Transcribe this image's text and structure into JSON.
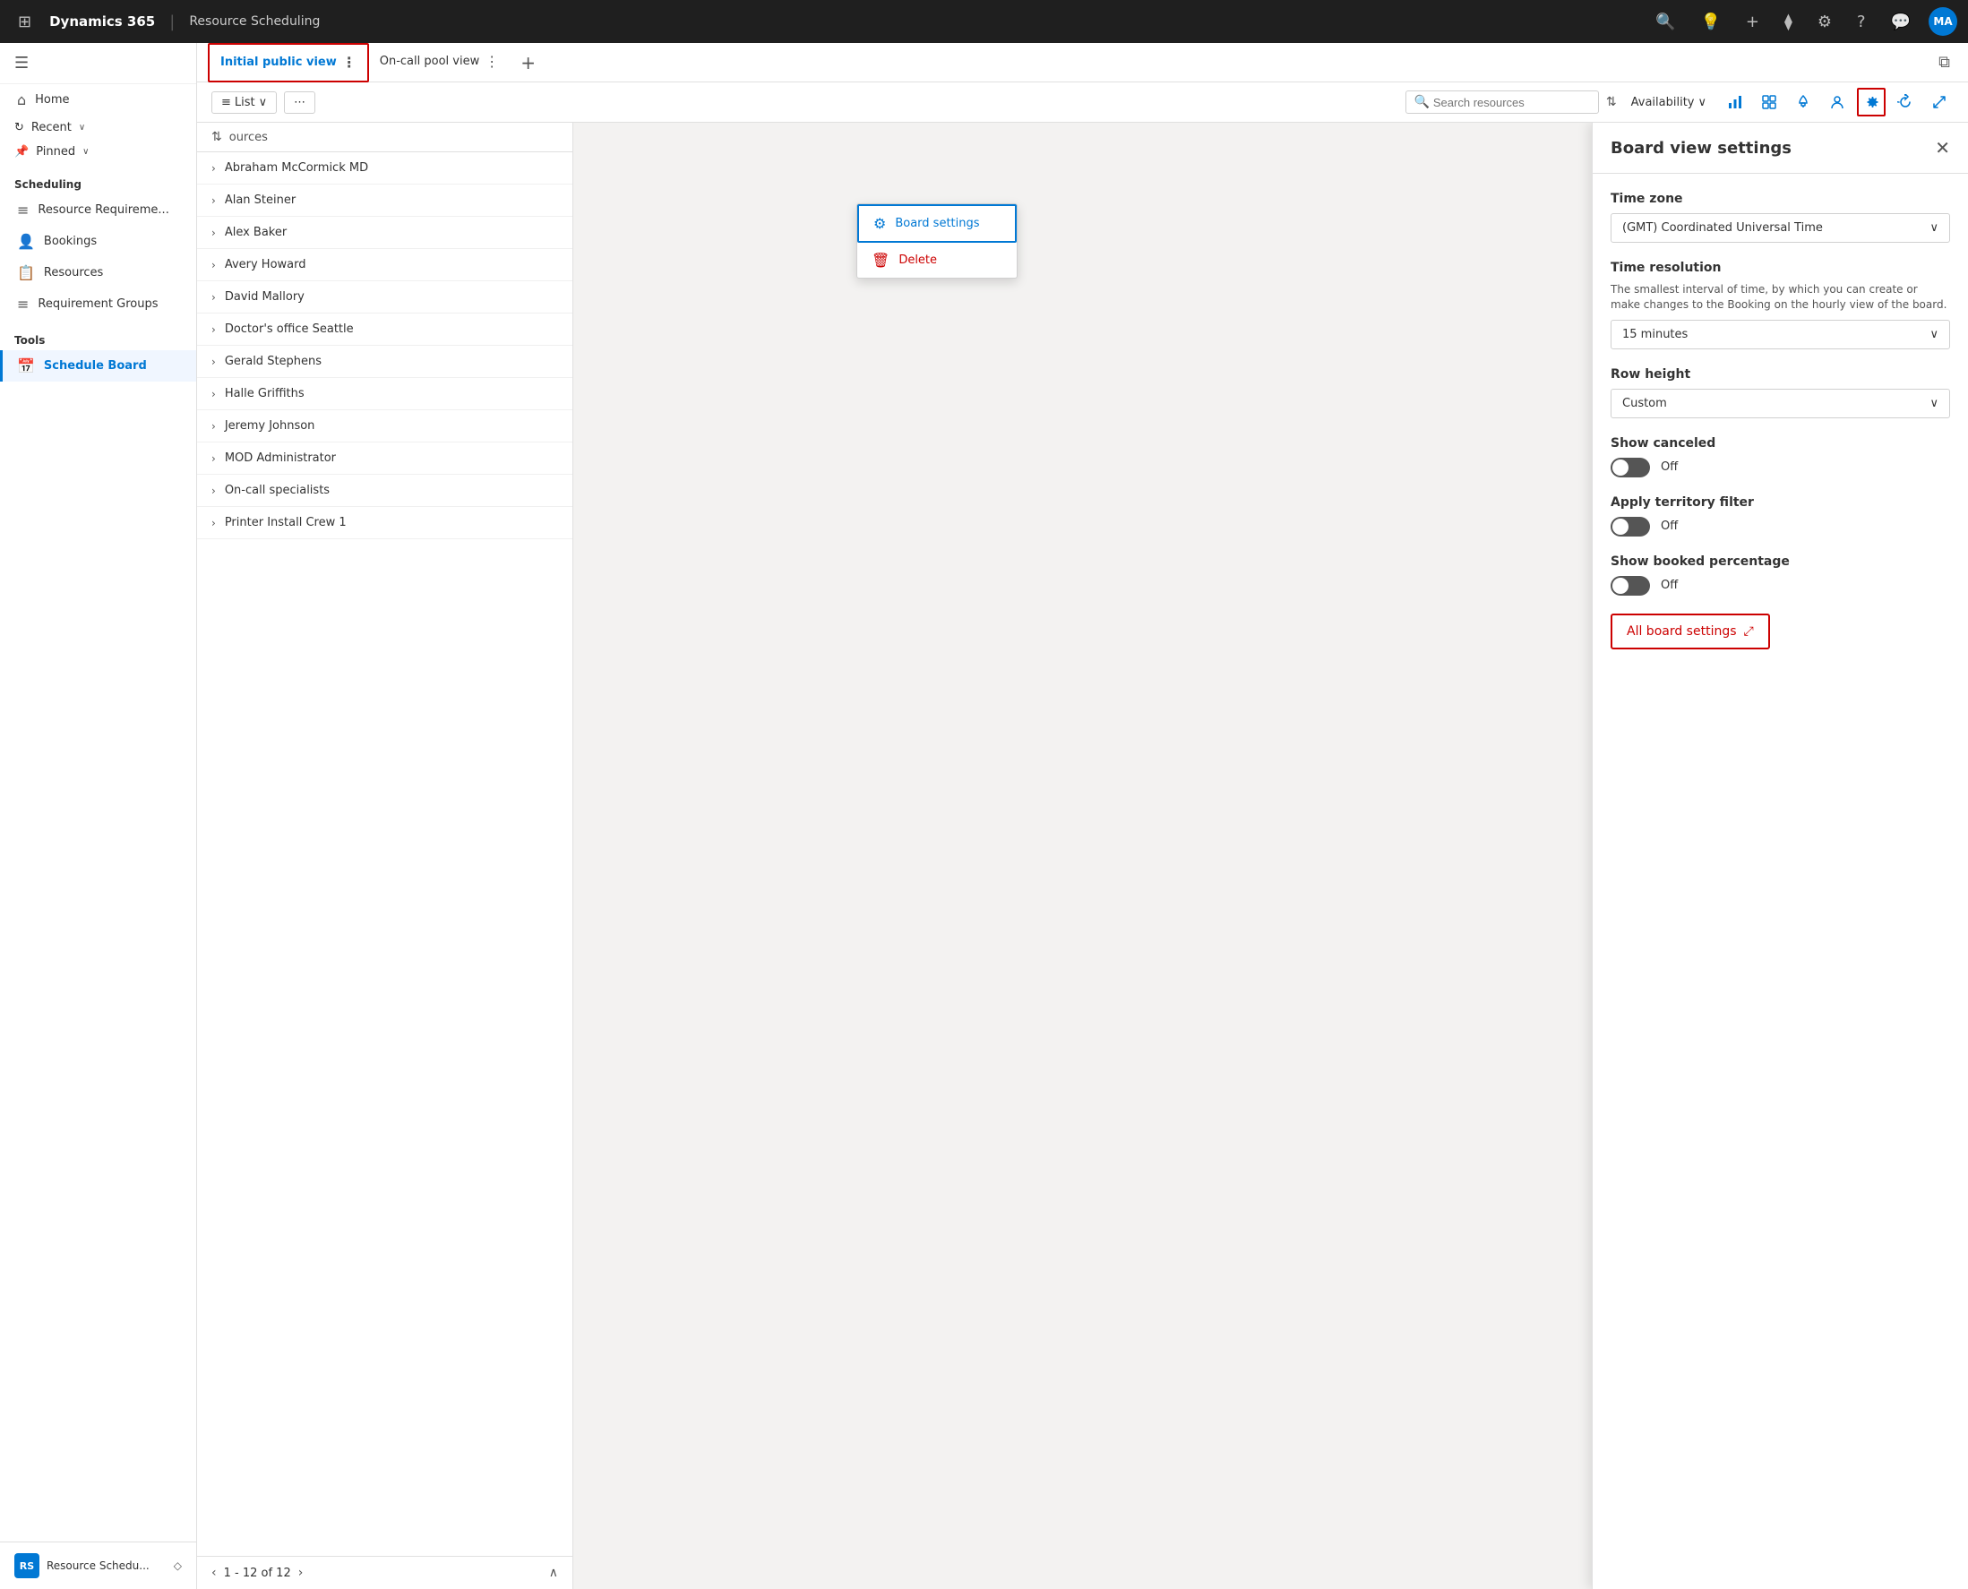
{
  "topNav": {
    "appGrid": "⊞",
    "brand": "Dynamics 365",
    "separator": "|",
    "moduleName": "Resource Scheduling",
    "icons": {
      "search": "🔍",
      "lightbulb": "💡",
      "plus": "+",
      "filter": "⧫",
      "gear": "⚙",
      "question": "?",
      "chat": "💬"
    },
    "avatar": {
      "initials": "MA",
      "bg": "#0078d4"
    }
  },
  "sidebar": {
    "hamburger": "☰",
    "navItems": [
      {
        "id": "home",
        "icon": "⌂",
        "label": "Home"
      },
      {
        "id": "recent",
        "icon": "↻",
        "label": "Recent",
        "hasChevron": true
      },
      {
        "id": "pinned",
        "icon": "📌",
        "label": "Pinned",
        "hasChevron": true
      }
    ],
    "sections": [
      {
        "label": "Scheduling",
        "items": [
          {
            "id": "resource-req",
            "icon": "≡",
            "label": "Resource Requireme..."
          },
          {
            "id": "bookings",
            "icon": "👤",
            "label": "Bookings"
          },
          {
            "id": "resources",
            "icon": "📋",
            "label": "Resources"
          },
          {
            "id": "req-groups",
            "icon": "≡",
            "label": "Requirement Groups"
          }
        ]
      },
      {
        "label": "Tools",
        "items": [
          {
            "id": "schedule-board",
            "icon": "📅",
            "label": "Schedule Board",
            "active": true
          }
        ]
      }
    ],
    "footer": {
      "initials": "RS",
      "text": "Resource Schedu...",
      "chevron": "◇"
    }
  },
  "tabs": [
    {
      "id": "initial-public",
      "label": "Initial public view",
      "active": true,
      "highlighted": true,
      "moreIcon": "⋮"
    },
    {
      "id": "on-call-pool",
      "label": "On-call pool view",
      "active": false,
      "moreIcon": "⋮"
    }
  ],
  "addTabIcon": "+",
  "toolbar": {
    "listBtn": {
      "icon": "≡",
      "label": "List",
      "chevron": "∨"
    },
    "moreBtn": "⋯",
    "rightIcons": [
      {
        "id": "reports",
        "icon": "📊",
        "title": "Reports"
      },
      {
        "id": "view-all",
        "icon": "⊞",
        "title": "View all"
      },
      {
        "id": "alerts",
        "icon": "🔔",
        "title": "Alerts"
      },
      {
        "id": "person",
        "icon": "👤",
        "title": "Person"
      },
      {
        "id": "settings",
        "icon": "⚙",
        "title": "Settings",
        "highlighted": true
      },
      {
        "id": "refresh",
        "icon": "↺",
        "title": "Refresh"
      },
      {
        "id": "expand",
        "icon": "⤢",
        "title": "Expand"
      }
    ],
    "searchPlaceholder": "Search resources",
    "sortIcon": "⇅",
    "availabilityLabel": "Availability",
    "availabilityChevron": "∨"
  },
  "resourceList": {
    "header": {
      "sortIcon": "⇅",
      "label": "ources"
    },
    "resources": [
      {
        "id": 1,
        "name": "Abraham McCormick MD"
      },
      {
        "id": 2,
        "name": "Alan Steiner"
      },
      {
        "id": 3,
        "name": "Alex Baker"
      },
      {
        "id": 4,
        "name": "Avery Howard"
      },
      {
        "id": 5,
        "name": "David Mallory"
      },
      {
        "id": 6,
        "name": "Doctor's office Seattle"
      },
      {
        "id": 7,
        "name": "Gerald Stephens"
      },
      {
        "id": 8,
        "name": "Halle Griffiths"
      },
      {
        "id": 9,
        "name": "Jeremy Johnson"
      },
      {
        "id": 10,
        "name": "MOD Administrator"
      },
      {
        "id": 11,
        "name": "On-call specialists"
      },
      {
        "id": 12,
        "name": "Printer Install Crew 1"
      }
    ],
    "pagination": {
      "prevIcon": "‹",
      "nextIcon": "›",
      "upIcon": "∧",
      "info": "1 - 12 of 12"
    }
  },
  "contextMenu": {
    "items": [
      {
        "id": "board-settings",
        "icon": "⚙",
        "label": "Board settings",
        "active": true
      },
      {
        "id": "delete",
        "icon": "🗑",
        "label": "Delete",
        "danger": true
      }
    ]
  },
  "settingsPanel": {
    "title": "Board view settings",
    "closeIcon": "✕",
    "fields": {
      "timezone": {
        "label": "Time zone",
        "value": "(GMT) Coordinated Universal Time",
        "chevron": "∨"
      },
      "timeResolution": {
        "label": "Time resolution",
        "description": "The smallest interval of time, by which you can create or make changes to the Booking on the hourly view of the board.",
        "value": "15 minutes",
        "chevron": "∨"
      },
      "rowHeight": {
        "label": "Row height",
        "value": "Custom",
        "chevron": "∨"
      },
      "showCanceled": {
        "label": "Show canceled",
        "toggleState": "off",
        "toggleLabel": "Off"
      },
      "applyTerritoryFilter": {
        "label": "Apply territory filter",
        "toggleState": "off",
        "toggleLabel": "Off"
      },
      "showBookedPercentage": {
        "label": "Show booked percentage",
        "toggleState": "off",
        "toggleLabel": "Off"
      }
    },
    "allBoardSettings": {
      "label": "All board settings",
      "icon": "⤢"
    }
  }
}
